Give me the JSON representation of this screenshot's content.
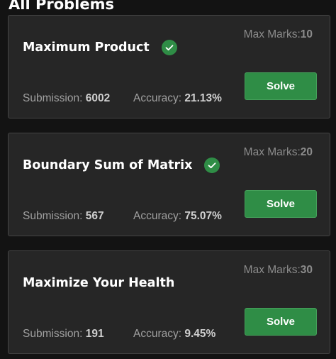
{
  "page": {
    "section_title": "All Problems"
  },
  "colors": {
    "accent_green": "#2f8d46",
    "card_bg": "#262626",
    "page_bg": "#131313"
  },
  "problems": [
    {
      "title": "Maximum Product",
      "solved": true,
      "solved_icon": "check-circle-icon",
      "max_marks_label": "Max Marks:",
      "max_marks": "10",
      "submission_label": "Submission: ",
      "submissions": "6002",
      "accuracy_label": "Accuracy: ",
      "accuracy": "21.13%",
      "button_label": "Solve"
    },
    {
      "title": "Boundary Sum of Matrix",
      "solved": true,
      "solved_icon": "check-circle-icon",
      "max_marks_label": "Max Marks:",
      "max_marks": "20",
      "submission_label": "Submission: ",
      "submissions": "567",
      "accuracy_label": "Accuracy: ",
      "accuracy": "75.07%",
      "button_label": "Solve"
    },
    {
      "title": "Maximize Your Health",
      "solved": false,
      "max_marks_label": "Max Marks:",
      "max_marks": "30",
      "submission_label": "Submission: ",
      "submissions": "191",
      "accuracy_label": "Accuracy: ",
      "accuracy": "9.45%",
      "button_label": "Solve"
    }
  ]
}
